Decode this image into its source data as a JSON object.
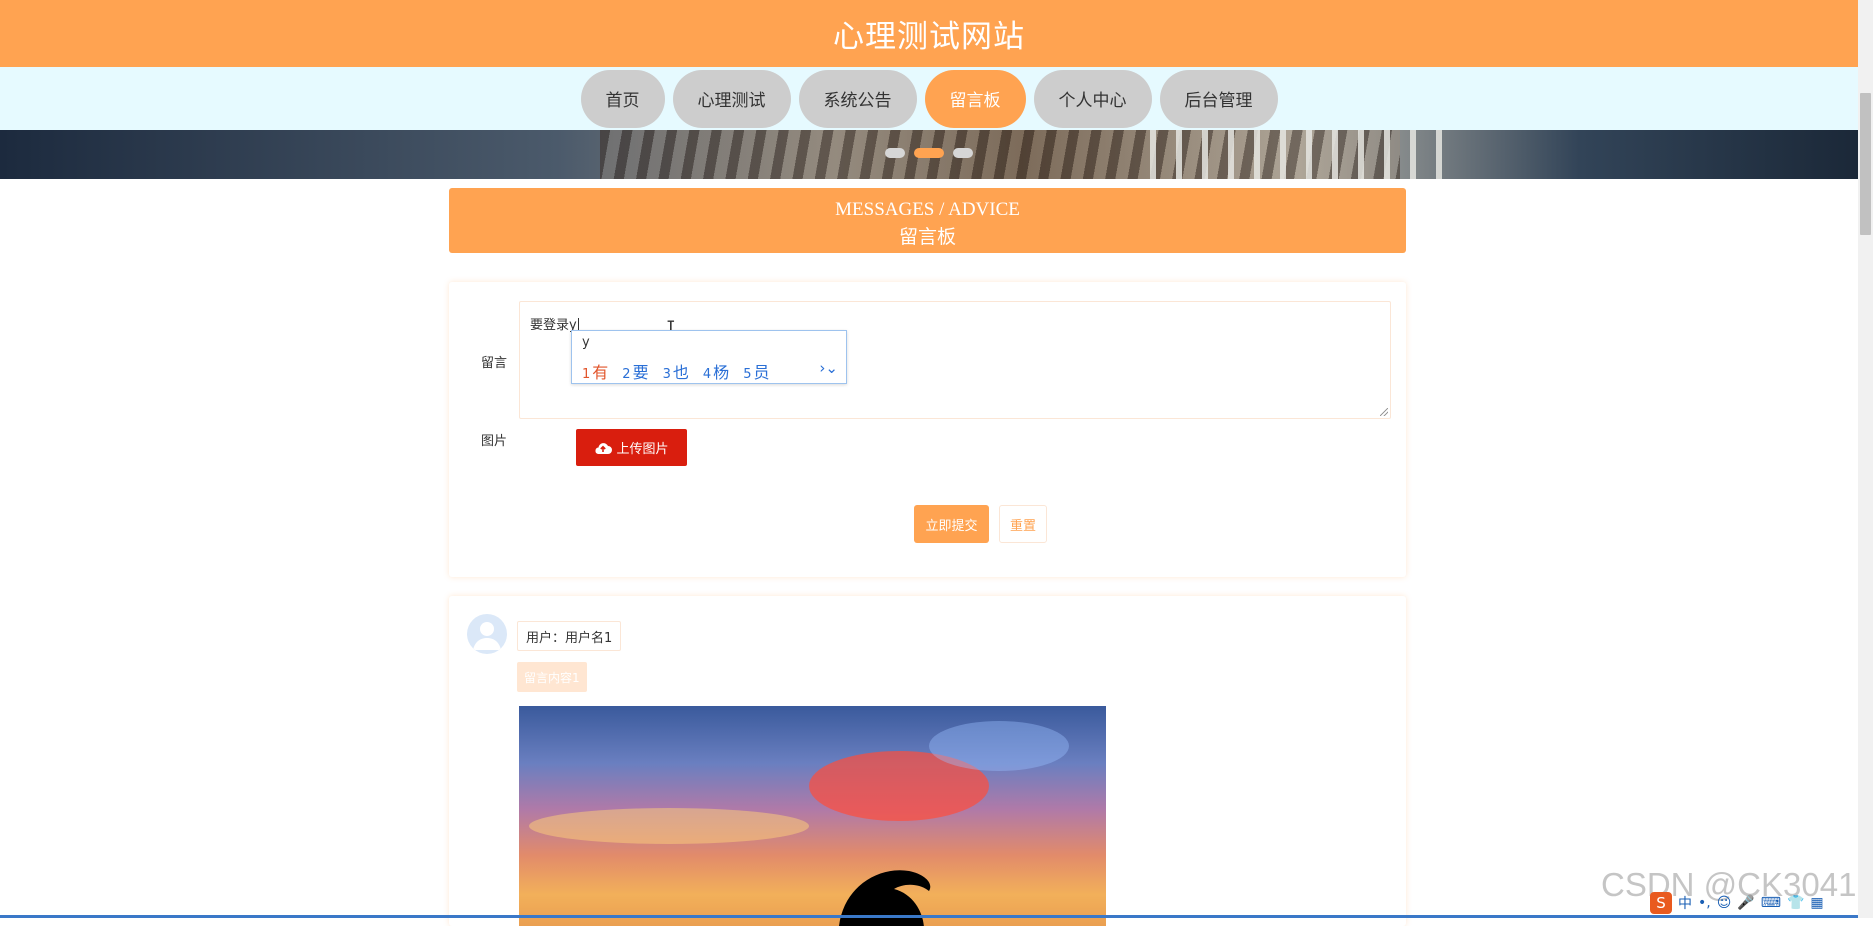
{
  "header": {
    "title": "心理测试网站"
  },
  "nav": {
    "items": [
      {
        "label": "首页"
      },
      {
        "label": "心理测试"
      },
      {
        "label": "系统公告"
      },
      {
        "label": "留言板",
        "active": true
      },
      {
        "label": "个人中心"
      },
      {
        "label": "后台管理"
      }
    ]
  },
  "carousel": {
    "active_index": 1
  },
  "section": {
    "title_en": "MESSAGES / ADVICE",
    "title_cn": "留言板"
  },
  "form": {
    "message_label": "留言",
    "message_value": "要登录y",
    "image_label": "图片",
    "upload_label": "上传图片",
    "submit_label": "立即提交",
    "reset_label": "重置"
  },
  "ime": {
    "pinyin": "y",
    "candidates": [
      {
        "num": "1",
        "char": "有"
      },
      {
        "num": "2",
        "char": "要"
      },
      {
        "num": "3",
        "char": "也"
      },
      {
        "num": "4",
        "char": "杨"
      },
      {
        "num": "5",
        "char": "员"
      }
    ]
  },
  "message_item": {
    "user_text": "用户：用户名1",
    "content_text": "留言内容1"
  },
  "watermark": "CSDN @CK3041",
  "tray": {
    "lang": "中"
  },
  "colors": {
    "accent": "#FFA351",
    "nav_bg": "#E6FAFF",
    "upload": "#D91E0E"
  }
}
